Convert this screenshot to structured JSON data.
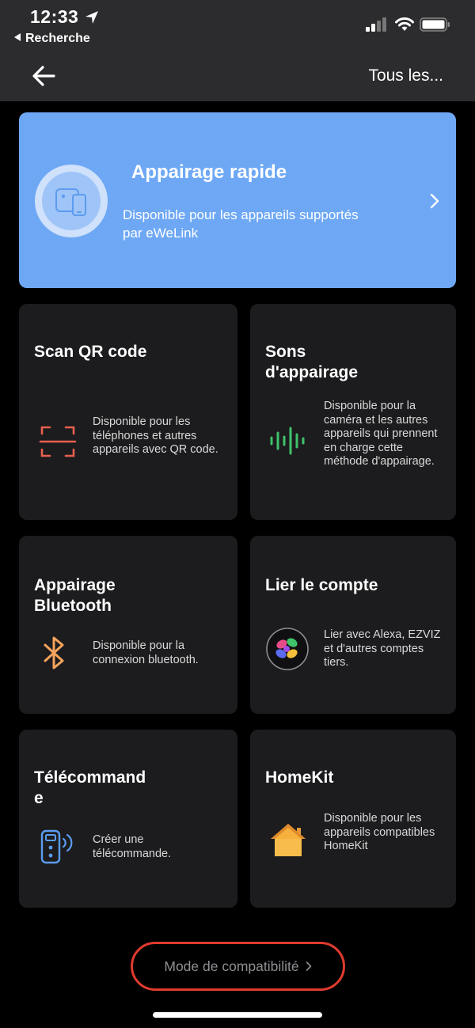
{
  "status_bar": {
    "time": "12:33",
    "back_app": "Recherche"
  },
  "nav": {
    "right_label": "Tous les..."
  },
  "banner": {
    "title": "Appairage rapide",
    "description": "Disponible pour les appareils supportés par eWeLink",
    "bg_color": "#6ea8f5"
  },
  "cards": [
    {
      "title": "Scan QR code",
      "description": "Disponible pour les téléphones et autres appareils avec QR code.",
      "icon": "qr-scan-icon",
      "icon_color": "#e8604c"
    },
    {
      "title": "Sons d'appairage",
      "description": "Disponible pour la caméra et les autres appareils qui prennent en charge cette méthode d'appairage.",
      "icon": "sound-wave-icon",
      "icon_color": "#3fc26a"
    },
    {
      "title": "Appairage Bluetooth",
      "description": "Disponible pour la connexion bluetooth.",
      "icon": "bluetooth-icon",
      "icon_color": "#f5a35c"
    },
    {
      "title": "Lier le compte",
      "description": "Lier avec Alexa, EZVIZ et d'autres comptes tiers.",
      "icon": "link-account-icon",
      "icon_color": "#ffffff"
    },
    {
      "title": "Télécommande",
      "description": "Créer une télécommande.",
      "icon": "remote-control-icon",
      "icon_color": "#5b9cf0"
    },
    {
      "title": "HomeKit",
      "description": "Disponible pour les appareils compatibles HomeKit",
      "icon": "homekit-icon",
      "icon_color": "#f5b13c"
    }
  ],
  "footer": {
    "compat_label": "Mode de compatibilité",
    "highlight_color": "#e03b2e"
  }
}
